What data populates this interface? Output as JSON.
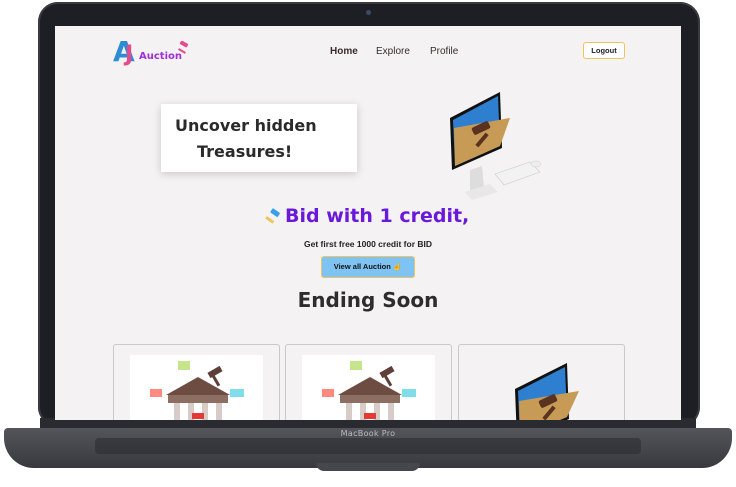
{
  "device": {
    "model_label": "MacBook Pro"
  },
  "brand": {
    "logo_letters": "A",
    "logo_letter2": "J",
    "name": "Auction"
  },
  "nav": {
    "items": [
      {
        "label": "Home",
        "active": true
      },
      {
        "label": "Explore",
        "active": false
      },
      {
        "label": "Profile",
        "active": false
      }
    ],
    "logout_label": "Logout"
  },
  "hero": {
    "line1": "Uncover hidden",
    "line2": "Treasures!"
  },
  "promo": {
    "headline": "Bid with 1 credit,",
    "subtext": "Get first free 1000 credit for BID",
    "cta_label": "View all Auction ☝"
  },
  "section": {
    "title": "Ending Soon"
  },
  "cards": [
    {
      "image_icon": "courthouse-illustration"
    },
    {
      "image_icon": "courthouse-illustration"
    },
    {
      "image_icon": "computer-gavel-illustration"
    }
  ],
  "colors": {
    "accent_purple": "#6a18d9",
    "button_blue": "#7fc3f2",
    "button_border": "#f0c45a",
    "logo_blue": "#2e8bd6",
    "logo_pink": "#e64a8c"
  }
}
